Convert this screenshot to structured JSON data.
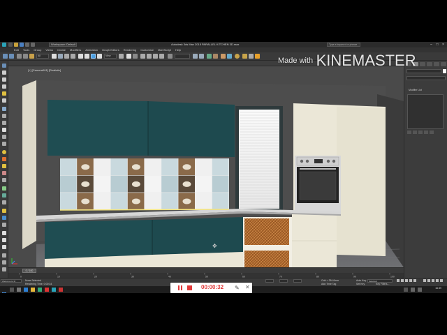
{
  "window": {
    "workspace": "Workspace: Default",
    "title": "Autodesk 3ds Max 2015   PARALLEL KITCHEN 3D.max",
    "search_placeholder": "Type a keyword or phrase"
  },
  "menu": [
    "Edit",
    "Tools",
    "Group",
    "Views",
    "Create",
    "Modifiers",
    "Animation",
    "Graph Editors",
    "Rendering",
    "Customize",
    "MAXScript",
    "Help"
  ],
  "toolbar": {
    "selection_filter": "All",
    "view_dropdown": "View"
  },
  "viewport": {
    "label": "[+] [Camera001] [Realistic]"
  },
  "right_panel": {
    "modifier_list": "Modifier List"
  },
  "timeline": {
    "frame_display": "0 / 100",
    "ticks": [
      "0",
      "10",
      "20",
      "30",
      "40",
      "50",
      "60",
      "70",
      "80",
      "90",
      "100"
    ]
  },
  "status": {
    "selection": "None Selected",
    "prompt": "Rendering Time: 0:00:34",
    "grid": "Grid = 254.0mm",
    "add_time_tag": "Add Time Tag",
    "auto_key": "Auto Key",
    "set_key": "Set Key",
    "selected": "Selected",
    "key_filters": "Key Filters...",
    "maxscript": "Welcome to M"
  },
  "taskbar": {
    "time": "16:39"
  },
  "recorder": {
    "timer": "00:00:32"
  },
  "watermark": {
    "made_with": "Made with",
    "brand": "KINEMASTER"
  },
  "colors": {
    "cabinet_teal": "#1f4d52",
    "cabinet_cream": "#ebe7d7",
    "floor": "#6b6c6e",
    "countertop": "#d6d6d6",
    "wicker": "#b06a2e",
    "recorder_red": "#e23a3a"
  }
}
